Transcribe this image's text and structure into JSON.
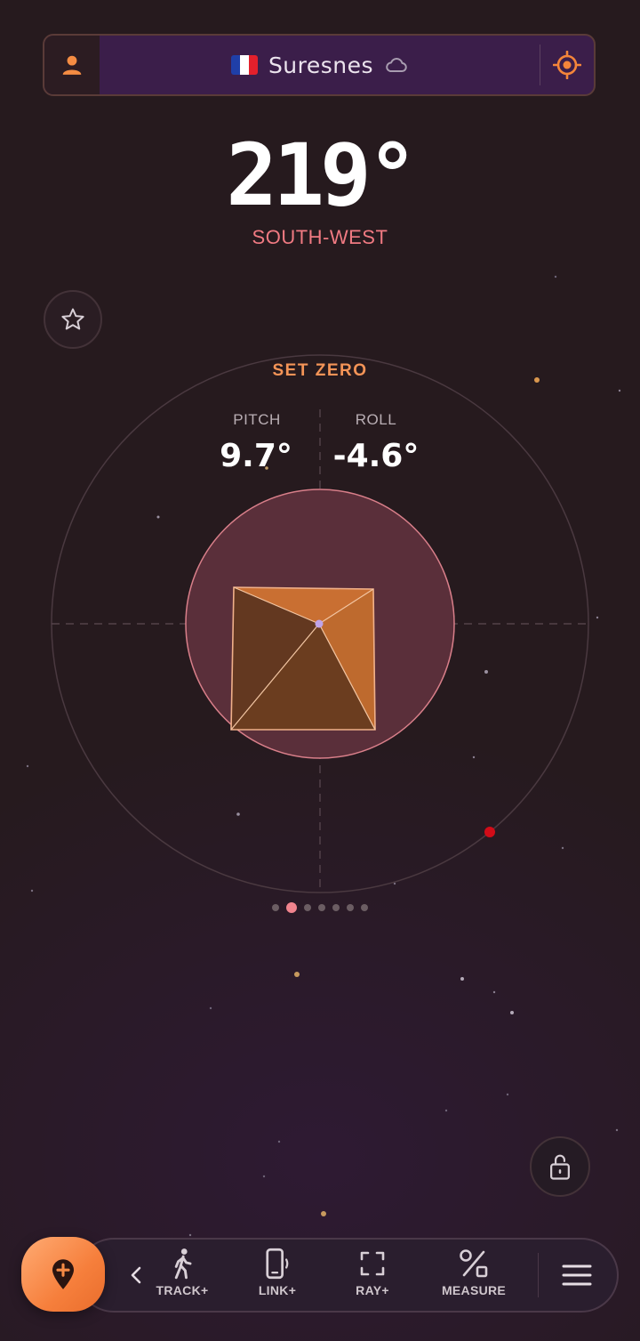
{
  "header": {
    "city": "Suresnes",
    "country_flag": "france-flag",
    "weather_icon": "cloud-icon",
    "user_icon": "user-icon",
    "locate_icon": "crosshair-target-icon"
  },
  "compass": {
    "heading": "219°",
    "direction": "SOUTH-WEST"
  },
  "level": {
    "set_zero_label": "SET ZERO",
    "pitch_label": "PITCH",
    "pitch_value": "9.7°",
    "roll_label": "ROLL",
    "roll_value": "-4.6°"
  },
  "pager": {
    "page_count": 7,
    "active_index": 1
  },
  "toolbar": {
    "add_pin_icon": "map-pin-plus-icon",
    "items": [
      {
        "label": "TRACK+",
        "icon": "walking-person-icon"
      },
      {
        "label": "LINK+",
        "icon": "phone-vibrate-icon"
      },
      {
        "label": "RAY+",
        "icon": "scan-frame-icon"
      },
      {
        "label": "MEASURE",
        "icon": "measure-percent-icon"
      }
    ],
    "menu_icon": "hamburger-menu-icon"
  },
  "colors": {
    "accent_orange": "#f49457",
    "direction_pink": "#f07a82",
    "bubble_fill": "#5a2f3a",
    "bubble_stroke": "#d97f8a",
    "pyramid_light": "#c96f32",
    "pyramid_dark": "#653a1f",
    "marker_red": "#d10c18"
  }
}
